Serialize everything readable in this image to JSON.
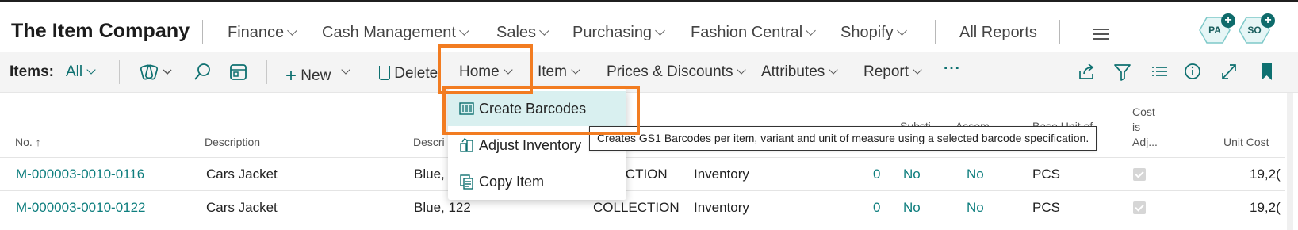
{
  "header": {
    "company": "The Item Company",
    "nav": [
      {
        "label": "Finance",
        "chevron": true
      },
      {
        "label": "Cash Management",
        "chevron": true
      },
      {
        "label": "Sales",
        "chevron": true
      },
      {
        "label": "Purchasing",
        "chevron": true
      },
      {
        "label": "Fashion Central",
        "chevron": true
      },
      {
        "label": "Shopify",
        "chevron": true
      }
    ],
    "all_reports": "All Reports",
    "menu_icon": "hamburger-icon",
    "badges": [
      {
        "initials": "PA",
        "icon": "plus-icon"
      },
      {
        "initials": "SO",
        "icon": "plus-icon"
      }
    ]
  },
  "actionbar": {
    "items_label": "Items:",
    "filter_value": "All",
    "icons": [
      "views-icon",
      "search-icon",
      "filter-pane-icon"
    ],
    "new_label": "New",
    "delete_label": "Delete",
    "menus": [
      "Home",
      "Item",
      "Prices & Discounts",
      "Attributes",
      "Report"
    ],
    "more_label": "···",
    "right_icons": [
      "share-icon",
      "filter-icon",
      "list-view-icon",
      "info-icon",
      "expand-icon",
      "bookmark-icon"
    ]
  },
  "dropdown": {
    "items": [
      {
        "label": "Create Barcodes",
        "icon": "barcode-icon",
        "highlighted": true
      },
      {
        "label": "Adjust Inventory",
        "icon": "adjust-inventory-icon",
        "highlighted": false
      },
      {
        "label": "Copy Item",
        "icon": "copy-icon",
        "highlighted": false
      }
    ]
  },
  "tooltip": "Creates GS1 Barcodes per item, variant and unit of measure using a selected barcode specification.",
  "grid": {
    "columns": {
      "no": "No. ↑",
      "description": "Description",
      "description2": "Descri",
      "substi": "Substi",
      "assem": "Assem",
      "base_unit": "Base Unit of",
      "cost_line1": "Cost",
      "cost_line2": "is",
      "cost_line3": "Adj...",
      "unit_cost": "Unit Cost"
    },
    "rows": [
      {
        "no": "M-000003-0010-0116",
        "description": "Cars Jacket",
        "description2": "Blue,",
        "category": "LECTION",
        "type": "Inventory",
        "qty": "0",
        "substi": "No",
        "assem": "No",
        "unit": "PCS",
        "cost_adj": true,
        "unit_cost": "19,2("
      },
      {
        "no": "M-000003-0010-0122",
        "description": "Cars Jacket",
        "description2": "Blue, 122",
        "category": "COLLECTION",
        "type": "Inventory",
        "qty": "0",
        "substi": "No",
        "assem": "No",
        "unit": "PCS",
        "cost_adj": true,
        "unit_cost": "19,2("
      }
    ]
  },
  "colors": {
    "accent": "#0e7e7e",
    "highlight_box": "#f27c21",
    "menu_highlight": "#d9f0f0"
  }
}
